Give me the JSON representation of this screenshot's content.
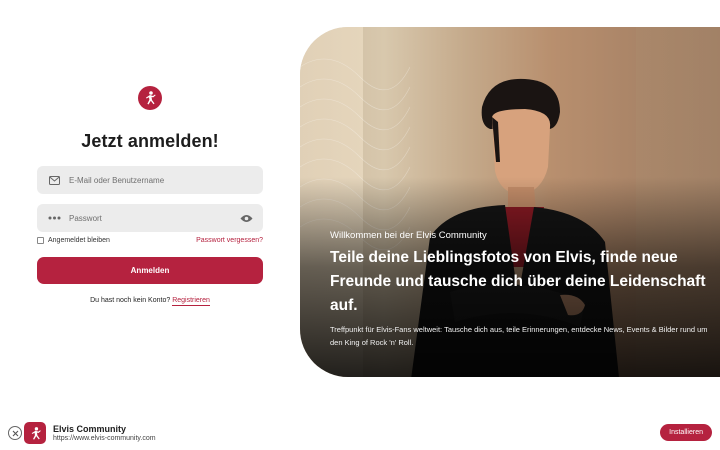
{
  "brand": {
    "accent": "#b5223f"
  },
  "login": {
    "logo_icon": "elvis-dancer-icon",
    "title": "Jetzt anmelden!",
    "email_placeholder": "E-Mail oder Benutzername",
    "password_placeholder": "Passwort",
    "remember_label": "Angemeldet bleiben",
    "forgot_label": "Passwort vergessen?",
    "submit_label": "Anmelden",
    "no_account_text": "Du hast noch kein Konto?",
    "register_label": "Registrieren"
  },
  "hero": {
    "welcome": "Willkommen bei der Elvis Community",
    "headline": "Teile deine Lieblingsfotos von Elvis, finde neue Freunde und tausche dich über deine Leidenschaft auf.",
    "subtext": "Treffpunkt für Elvis-Fans weltweit: Tausche dich aus, teile Erinnerungen, entdecke News, Events & Bilder rund um den King of Rock 'n' Roll."
  },
  "install_banner": {
    "app_name": "Elvis Community",
    "app_url": "https://www.elvis-community.com",
    "install_label": "Installieren"
  }
}
